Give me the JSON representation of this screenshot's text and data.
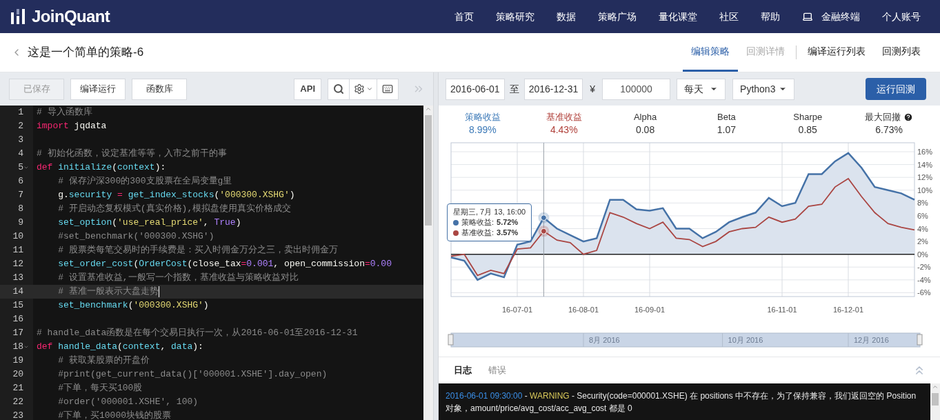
{
  "header": {
    "logo": "JoinQuant",
    "nav": [
      {
        "label": "首页",
        "icon": false
      },
      {
        "label": "策略研究",
        "icon": false
      },
      {
        "label": "数据",
        "icon": false
      },
      {
        "label": "策略广场",
        "icon": false
      },
      {
        "label": "量化课堂",
        "icon": false
      },
      {
        "label": "社区",
        "icon": false
      },
      {
        "label": "帮助",
        "icon": false
      },
      {
        "label": "金融终端",
        "icon": true
      },
      {
        "label": "个人账号",
        "icon": false
      }
    ]
  },
  "page": {
    "title": "这是一个简单的策略-6",
    "tabs": [
      {
        "label": "编辑策略",
        "selected": true,
        "disabled": false
      },
      {
        "label": "回测详情",
        "selected": false,
        "disabled": true
      },
      {
        "label": "编译运行列表",
        "selected": false,
        "disabled": false
      },
      {
        "label": "回测列表",
        "selected": false,
        "disabled": false
      }
    ]
  },
  "toolbar": {
    "buttons": [
      {
        "label": "已保存",
        "disabled": true
      },
      {
        "label": "编译运行",
        "disabled": false
      },
      {
        "label": "函数库",
        "disabled": false
      }
    ],
    "api": "API"
  },
  "editor": {
    "lines": [
      {
        "number": "1",
        "active": false,
        "foldable": false,
        "tokens": [
          {
            "kind": "comment",
            "text": "# 导入函数库"
          }
        ]
      },
      {
        "number": "2",
        "active": false,
        "foldable": false,
        "tokens": [
          {
            "kind": "keyword",
            "text": "import"
          },
          {
            "kind": "plain",
            "text": " jqdata"
          }
        ]
      },
      {
        "number": "3",
        "active": false,
        "foldable": false
      },
      {
        "number": "4",
        "active": false,
        "foldable": false,
        "tokens": [
          {
            "kind": "comment",
            "text": "# 初始化函数，设定基准等等，入市之前干的事"
          }
        ]
      },
      {
        "number": "5",
        "active": false,
        "foldable": true,
        "tokens": [
          {
            "kind": "keyword",
            "text": "def"
          },
          {
            "kind": "name",
            "text": " initialize"
          },
          {
            "kind": "plain",
            "text": "("
          },
          {
            "kind": "name",
            "text": "context"
          },
          {
            "kind": "plain",
            "text": "):"
          }
        ]
      },
      {
        "number": "6",
        "active": false,
        "foldable": false,
        "tokens": [
          {
            "kind": "comment",
            "text": "    # 保存沪深300的300支股票在全局变量g里"
          }
        ]
      },
      {
        "number": "7",
        "active": false,
        "foldable": false,
        "tokens": [
          {
            "kind": "plain",
            "text": "    g."
          },
          {
            "kind": "name",
            "text": "security"
          },
          {
            "kind": "op",
            "text": " = "
          },
          {
            "kind": "name",
            "text": "get_index_stocks"
          },
          {
            "kind": "plain",
            "text": "("
          },
          {
            "kind": "string",
            "text": "'000300.XSHG'"
          },
          {
            "kind": "plain",
            "text": ")"
          }
        ]
      },
      {
        "number": "8",
        "active": false,
        "foldable": false,
        "tokens": [
          {
            "kind": "comment",
            "text": "    # 开启动态复权模式(真实价格),模拟盘使用真实价格成交"
          }
        ]
      },
      {
        "number": "9",
        "active": false,
        "foldable": false,
        "tokens": [
          {
            "kind": "name",
            "text": "    set_option"
          },
          {
            "kind": "plain",
            "text": "("
          },
          {
            "kind": "string",
            "text": "'use_real_price'"
          },
          {
            "kind": "plain",
            "text": ", "
          },
          {
            "kind": "const",
            "text": "True"
          },
          {
            "kind": "plain",
            "text": ")"
          }
        ]
      },
      {
        "number": "10",
        "active": false,
        "foldable": false,
        "tokens": [
          {
            "kind": "comment",
            "text": "    #set_benchmark('000300.XSHG')"
          }
        ]
      },
      {
        "number": "11",
        "active": false,
        "foldable": false,
        "tokens": [
          {
            "kind": "comment",
            "text": "    # 股票类每笔交易时的手续费是：买入时佣金万分之三，卖出时佣金万"
          }
        ]
      },
      {
        "number": "12",
        "active": false,
        "foldable": false,
        "tokens": [
          {
            "kind": "name",
            "text": "    set_order_cost"
          },
          {
            "kind": "plain",
            "text": "("
          },
          {
            "kind": "name",
            "text": "OrderCost"
          },
          {
            "kind": "plain",
            "text": "(close_tax"
          },
          {
            "kind": "op",
            "text": "="
          },
          {
            "kind": "const",
            "text": "0.001"
          },
          {
            "kind": "plain",
            "text": ", open_commission"
          },
          {
            "kind": "op",
            "text": "="
          },
          {
            "kind": "const",
            "text": "0.00"
          }
        ]
      },
      {
        "number": "13",
        "active": false,
        "foldable": false,
        "tokens": [
          {
            "kind": "comment",
            "text": "    # 设置基准收益,一般写一个指数，基准收益与策略收益对比"
          }
        ]
      },
      {
        "number": "14",
        "active": true,
        "foldable": false,
        "tokens": [
          {
            "kind": "comment",
            "text": "    # 基准一般表示大盘走势"
          }
        ]
      },
      {
        "number": "15",
        "active": false,
        "foldable": false,
        "tokens": [
          {
            "kind": "name",
            "text": "    set_benchmark"
          },
          {
            "kind": "plain",
            "text": "("
          },
          {
            "kind": "string",
            "text": "'000300.XSHG'"
          },
          {
            "kind": "plain",
            "text": ")"
          }
        ]
      },
      {
        "number": "16",
        "active": false,
        "foldable": false
      },
      {
        "number": "17",
        "active": false,
        "foldable": false,
        "tokens": [
          {
            "kind": "comment",
            "text": "# handle_data函数是在每个交易日执行一次，从2016-06-01至2016-12-31"
          }
        ]
      },
      {
        "number": "18",
        "active": false,
        "foldable": true,
        "tokens": [
          {
            "kind": "keyword",
            "text": "def"
          },
          {
            "kind": "name",
            "text": " handle_data"
          },
          {
            "kind": "plain",
            "text": "("
          },
          {
            "kind": "name",
            "text": "context"
          },
          {
            "kind": "plain",
            "text": ", "
          },
          {
            "kind": "name",
            "text": "data"
          },
          {
            "kind": "plain",
            "text": "):"
          }
        ]
      },
      {
        "number": "19",
        "active": false,
        "foldable": false,
        "tokens": [
          {
            "kind": "comment",
            "text": "    # 获取某股票的开盘价"
          }
        ]
      },
      {
        "number": "20",
        "active": false,
        "foldable": false,
        "tokens": [
          {
            "kind": "comment",
            "text": "    #print(get_current_data()['000001.XSHE'].day_open)"
          }
        ]
      },
      {
        "number": "21",
        "active": false,
        "foldable": false,
        "tokens": [
          {
            "kind": "comment",
            "text": "    #下单，每天买100股"
          }
        ]
      },
      {
        "number": "22",
        "active": false,
        "foldable": false,
        "tokens": [
          {
            "kind": "comment",
            "text": "    #order('000001.XSHE', 100)"
          }
        ]
      },
      {
        "number": "23",
        "active": false,
        "foldable": false,
        "tokens": [
          {
            "kind": "comment",
            "text": "    #下单，买10000块钱的股票"
          }
        ]
      }
    ]
  },
  "backtest": {
    "start_date": "2016-06-01",
    "to": "至",
    "end_date": "2016-12-31",
    "currency": "¥",
    "capital": "100000",
    "frequency": "每天",
    "language": "Python3",
    "run_button": "运行回测"
  },
  "stats": [
    {
      "label": "策略收益",
      "value": "8.99%",
      "color": "#3d7ab8",
      "help": false
    },
    {
      "label": "基准收益",
      "value": "4.43%",
      "color": "#b0403a",
      "help": false
    },
    {
      "label": "Alpha",
      "value": "0.08",
      "color": "#333333",
      "help": false
    },
    {
      "label": "Beta",
      "value": "1.07",
      "color": "#333333",
      "help": false
    },
    {
      "label": "Sharpe",
      "value": "0.85",
      "color": "#333333",
      "help": false
    },
    {
      "label": "最大回撤",
      "value": "6.73%",
      "color": "#333333",
      "help": true
    }
  ],
  "chart": {
    "chart_data": {
      "type": "line",
      "categories": [
        null,
        null,
        null,
        null,
        null,
        "16-07-01",
        null,
        null,
        null,
        null,
        "16-08-01",
        null,
        null,
        null,
        null,
        "16-09-01",
        null,
        null,
        null,
        null,
        null,
        null,
        null,
        null,
        null,
        "16-11-01",
        null,
        null,
        null,
        null,
        "16-12-01",
        null,
        null,
        null,
        null,
        null
      ],
      "series": [
        {
          "name": "策略收益",
          "color": "#4572a7",
          "values": [
            -0.5,
            -1.0,
            -4.0,
            -3.0,
            -3.6,
            1.5,
            2.0,
            5.7,
            4.0,
            3.0,
            2.0,
            2.5,
            8.5,
            8.5,
            7.0,
            6.8,
            7.2,
            4.0,
            4.0,
            2.5,
            3.5,
            5.0,
            5.8,
            6.5,
            8.8,
            7.5,
            8.0,
            12.5,
            12.5,
            14.5,
            15.8,
            13.5,
            10.5,
            10.0,
            9.5,
            8.5
          ]
        },
        {
          "name": "基准收益",
          "color": "#aa4643",
          "values": [
            -0.3,
            0.0,
            -3.3,
            -2.5,
            -3.0,
            0.8,
            1.0,
            3.6,
            2.2,
            1.8,
            0.0,
            0.6,
            6.5,
            5.8,
            4.8,
            4.0,
            5.0,
            2.5,
            2.3,
            1.2,
            2.0,
            3.5,
            4.0,
            4.2,
            5.8,
            5.0,
            5.5,
            7.5,
            7.8,
            10.5,
            11.8,
            9.0,
            6.5,
            4.8,
            4.2,
            3.8
          ]
        }
      ],
      "ylim": [
        -6.6,
        17.4
      ],
      "grid": true,
      "yticks": [
        {
          "value": 16,
          "label": "16%"
        },
        {
          "value": 14,
          "label": "14%"
        },
        {
          "value": 12,
          "label": "12%"
        },
        {
          "value": 10,
          "label": "10%"
        },
        {
          "value": 8,
          "label": "8%"
        },
        {
          "value": 6,
          "label": "6%"
        },
        {
          "value": 4,
          "label": "4%"
        },
        {
          "value": 2,
          "label": "2%"
        },
        {
          "value": 0,
          "label": "0%"
        },
        {
          "value": -2,
          "label": "-2%"
        },
        {
          "value": -4,
          "label": "-4%"
        },
        {
          "value": -6,
          "label": "-6%"
        }
      ]
    },
    "tooltip": {
      "title": "星期三, 7月 13, 16:00",
      "separator": ":",
      "values": [
        "5.72%",
        "3.57%"
      ]
    },
    "navigator": {
      "labels": [
        "8月 2016",
        "10月 2016",
        "12月 2016"
      ]
    }
  },
  "log": {
    "tabs": [
      {
        "label": "日志",
        "selected": true
      },
      {
        "label": "错误",
        "selected": false
      }
    ],
    "entries": [
      [
        {
          "kind": "time",
          "text": "2016-06-01 09:30:00"
        },
        {
          "kind": "text",
          "text": " - "
        },
        {
          "kind": "level",
          "text": "WARNING"
        },
        {
          "kind": "text",
          "text": " - Security(code=000001.XSHE) 在 positions 中不存在，为了保持兼容，我们返回空的 Position 对象，amount/price/avg_cost/acc_avg_cost 都是 0"
        }
      ]
    ]
  }
}
